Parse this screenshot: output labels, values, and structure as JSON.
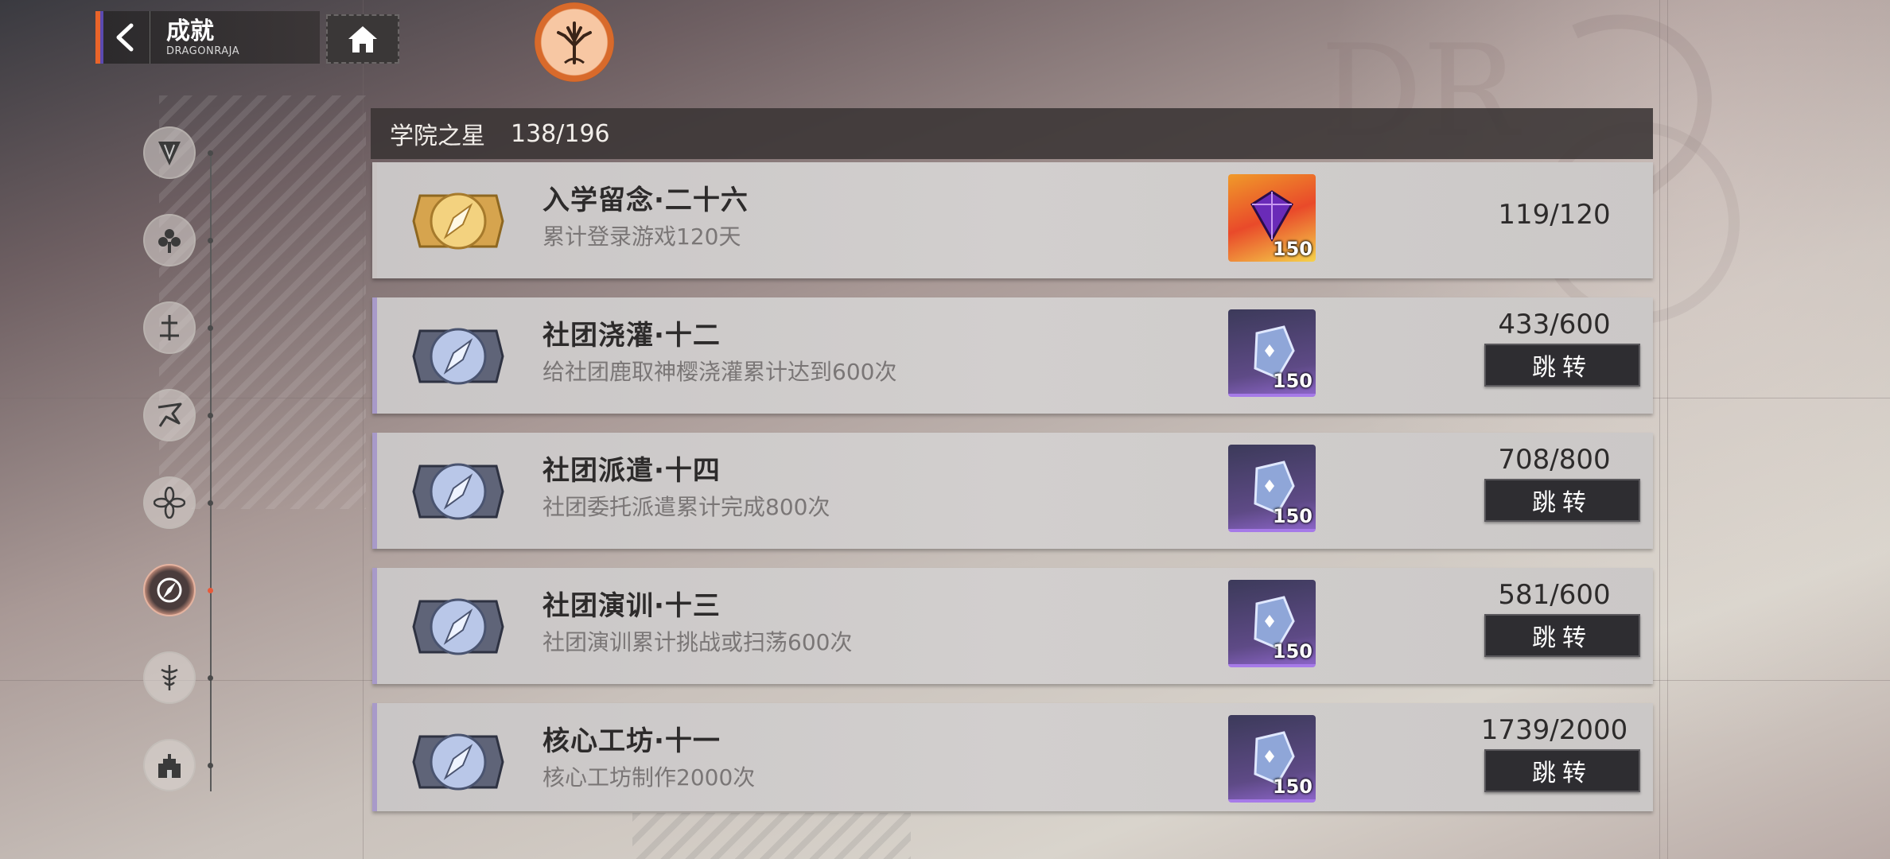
{
  "header": {
    "title": "成就",
    "subtitle": "DRAGONRAJA"
  },
  "nav_icons": [
    "shield-v-icon",
    "fleur-icon",
    "sword-icon",
    "bird-icon",
    "flower-icon",
    "compass-icon",
    "caduceus-icon",
    "castle-icon"
  ],
  "category": {
    "name": "学院之星",
    "count": "138/196"
  },
  "achievements": [
    {
      "title": "入学留念·二十六",
      "desc": "累计登录游戏120天",
      "reward_count": "150",
      "reward_icon": "purple-gem-icon",
      "progress": "119/120",
      "jump_label": ""
    },
    {
      "title": "社团浇灌·十二",
      "desc": "给社团鹿取神樱浇灌累计达到600次",
      "reward_count": "150",
      "reward_icon": "crystal-shard-icon",
      "progress": "433/600",
      "jump_label": "跳转"
    },
    {
      "title": "社团派遣·十四",
      "desc": "社团委托派遣累计完成800次",
      "reward_count": "150",
      "reward_icon": "crystal-shard-icon",
      "progress": "708/800",
      "jump_label": "跳转"
    },
    {
      "title": "社团演训·十三",
      "desc": "社团演训累计挑战或扫荡600次",
      "reward_count": "150",
      "reward_icon": "crystal-shard-icon",
      "progress": "581/600",
      "jump_label": "跳转"
    },
    {
      "title": "核心工坊·十一",
      "desc": "核心工坊制作2000次",
      "reward_count": "150",
      "reward_icon": "crystal-shard-icon",
      "progress": "1739/2000",
      "jump_label": "跳转"
    }
  ],
  "colors": {
    "accent_orange": "#e9642a",
    "accent_purple": "#5b4ab0",
    "active_dot": "#e85a3a"
  }
}
